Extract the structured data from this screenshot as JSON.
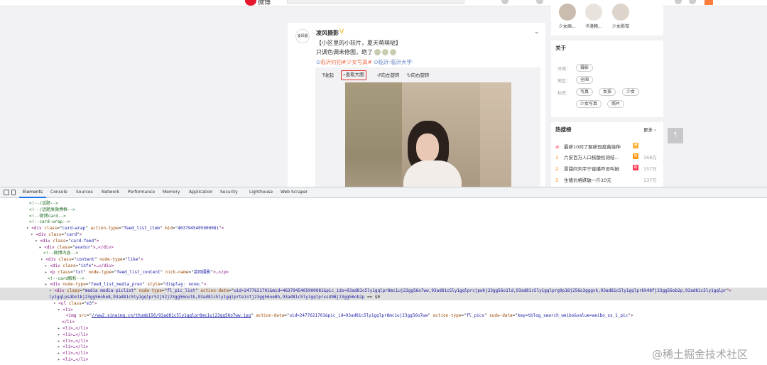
{
  "top_nav": {
    "logo_text": "微博",
    "items": [
      "",
      "",
      "",
      "",
      "",
      ""
    ]
  },
  "feed": {
    "avatar_text": "凌风摄影",
    "user_name": "凌风摄影",
    "verified_mark": "V",
    "line1": "【小区里的小较片，夏天萌萌哒】",
    "line2": "只调色调未修图，绝了",
    "tag1": "临沂约拍",
    "tag2": "#少女写真#",
    "location": "临沂·临沂大学",
    "toolbar": {
      "collapse": "收起",
      "view_large": "查看大图",
      "rotate_left": "向左旋转",
      "rotate_right": "向右旋转"
    }
  },
  "sidebar": {
    "fans": [
      {
        "name": "少女画..."
      },
      {
        "name": "卡洛赖..."
      },
      {
        "name": "少女影馆"
      }
    ],
    "about": {
      "title": "关于",
      "category_label": "分类：",
      "category_value": "摄影",
      "region_label": "地区：",
      "region_value": "全国",
      "tags_label": "标签：",
      "tags": [
        "写真",
        "女孩",
        "少女",
        "少女写真",
        "照片"
      ]
    },
    "hot": {
      "title": "热搜榜",
      "more": "更多 ›",
      "items": [
        {
          "rank": "",
          "text": "最新10问了解新冠疫苗接种",
          "badge": "荐",
          "badge_color": "#ffab2d",
          "count": ""
        },
        {
          "rank": "1",
          "text": "六安百万人口核酸检测结...",
          "badge": "热",
          "badge_color": "#ff9406",
          "count": "168万"
        },
        {
          "rank": "2",
          "text": "景甜问刘宇宁直播咋没叫她",
          "badge": "新",
          "badge_color": "#ff3852",
          "count": "157万"
        },
        {
          "rank": "3",
          "text": "生猪价格跌破一斤10元",
          "badge": "",
          "badge_color": "",
          "count": "137万"
        }
      ]
    },
    "scroll_top": "↑"
  },
  "devtools": {
    "tabs": [
      "Elements",
      "Console",
      "Sources",
      "Network",
      "Performance",
      "Memory",
      "Application",
      "Security",
      "Lighthouse",
      "Web Scraper"
    ],
    "active_tab": "Elements"
  },
  "code_lines": [
    {
      "c": "<!--/话题-->"
    },
    {
      "c": "<!--/话题发微博框-->"
    },
    {
      "c": "<!--微博card-->"
    },
    {
      "c": "<!--card-wrap-->"
    },
    {
      "tag": "div",
      "attrs": [
        [
          "class",
          "card-wrap"
        ],
        [
          "action-type",
          "feed_list_item"
        ],
        [
          "mid",
          "4637945405900081"
        ]
      ]
    },
    {
      "tag": "div",
      "attrs": [
        [
          "class",
          "card"
        ]
      ]
    },
    {
      "tag": "div",
      "attrs": [
        [
          "class",
          "card-feed"
        ]
      ]
    },
    {
      "tag": "div",
      "attrs": [
        [
          "class",
          "avator"
        ]
      ],
      "tail": "…</div>"
    },
    {
      "c": "<!--微博内容-->"
    },
    {
      "tag": "div",
      "attrs": [
        [
          "class",
          "content"
        ],
        [
          "node-type",
          "like"
        ]
      ]
    },
    {
      "tag": "div",
      "attrs": [
        [
          "class",
          "info"
        ]
      ],
      "tail": "…</div>"
    },
    {
      "tag": "p",
      "attrs": [
        [
          "class",
          "txt"
        ],
        [
          "node-type",
          "feed_list_content"
        ],
        [
          "nick-name",
          "凌风摄影"
        ]
      ],
      "tail": "…</p>"
    },
    {
      "c": "<!--card解析-->"
    },
    {
      "tag": "div",
      "attrs": [
        [
          "node-type",
          "feed_list_media_prev"
        ],
        [
          "style",
          "display: none;"
        ]
      ]
    },
    {
      "tag": "div",
      "attrs": [
        [
          "class",
          "media media-piclist"
        ],
        [
          "node-type",
          "fl_pic_list"
        ],
        [
          "action-data",
          "uid=2477621701&mid=4637945405900081&pic_ids=93ad81c5ly1gqlpr8mc1uj23gg56o7ww,93ad81c5ly1gqlprcjpwhj23gg56o1ld,93ad81c5ly1gqlprg9p18j256o3gggvk,93ad81c5ly1gqlprkh48fj23gg56ob2p,93ad81c5ly1gqlpr"
        ]
      ]
    },
    {
      "cont": "ly1gqlps4bnlkj23gg56ohe8,93ad81c5ly1gqlpr52j52j23gg56oulb,93ad81c5ly1gqlprteintj23gg56oeBh,93ad81c5ly1gqlprxs49Bj23gg56ob2p",
      "tail": " == $0"
    },
    {
      "tag": "ul",
      "attrs": [
        [
          "class",
          "m3"
        ]
      ]
    },
    {
      "tag": "li",
      "attrs": []
    },
    {
      "tag": "img",
      "attrs": [
        [
          "src",
          "//ww2.sinaimg.cn/thumb150/93ad81c5ly1gqlpr8mc1uj23gg56o7ww.jpg"
        ],
        [
          "action-data",
          "uid=2477621701&pic_id=93ad81c5ly1gqlpr8mc1uj23gg56o7ww"
        ],
        [
          "action-type",
          "fl_pics"
        ],
        [
          "suda-data",
          "key=tblog_search_weibo&value=weibo_ss_1_pic"
        ]
      ]
    },
    {
      "close": "</li>"
    },
    {
      "tag": "li",
      "attrs": [],
      "tail": "…</li>"
    },
    {
      "tag": "li",
      "attrs": [],
      "tail": "…</li>"
    },
    {
      "tag": "li",
      "attrs": [],
      "tail": "…</li>"
    },
    {
      "tag": "li",
      "attrs": [],
      "tail": "…</li>"
    },
    {
      "tag": "li",
      "attrs": [],
      "tail": "…</li>"
    },
    {
      "tag": "li",
      "attrs": [],
      "tail": "…</li>"
    }
  ],
  "watermark": "@稀土掘金技术社区"
}
